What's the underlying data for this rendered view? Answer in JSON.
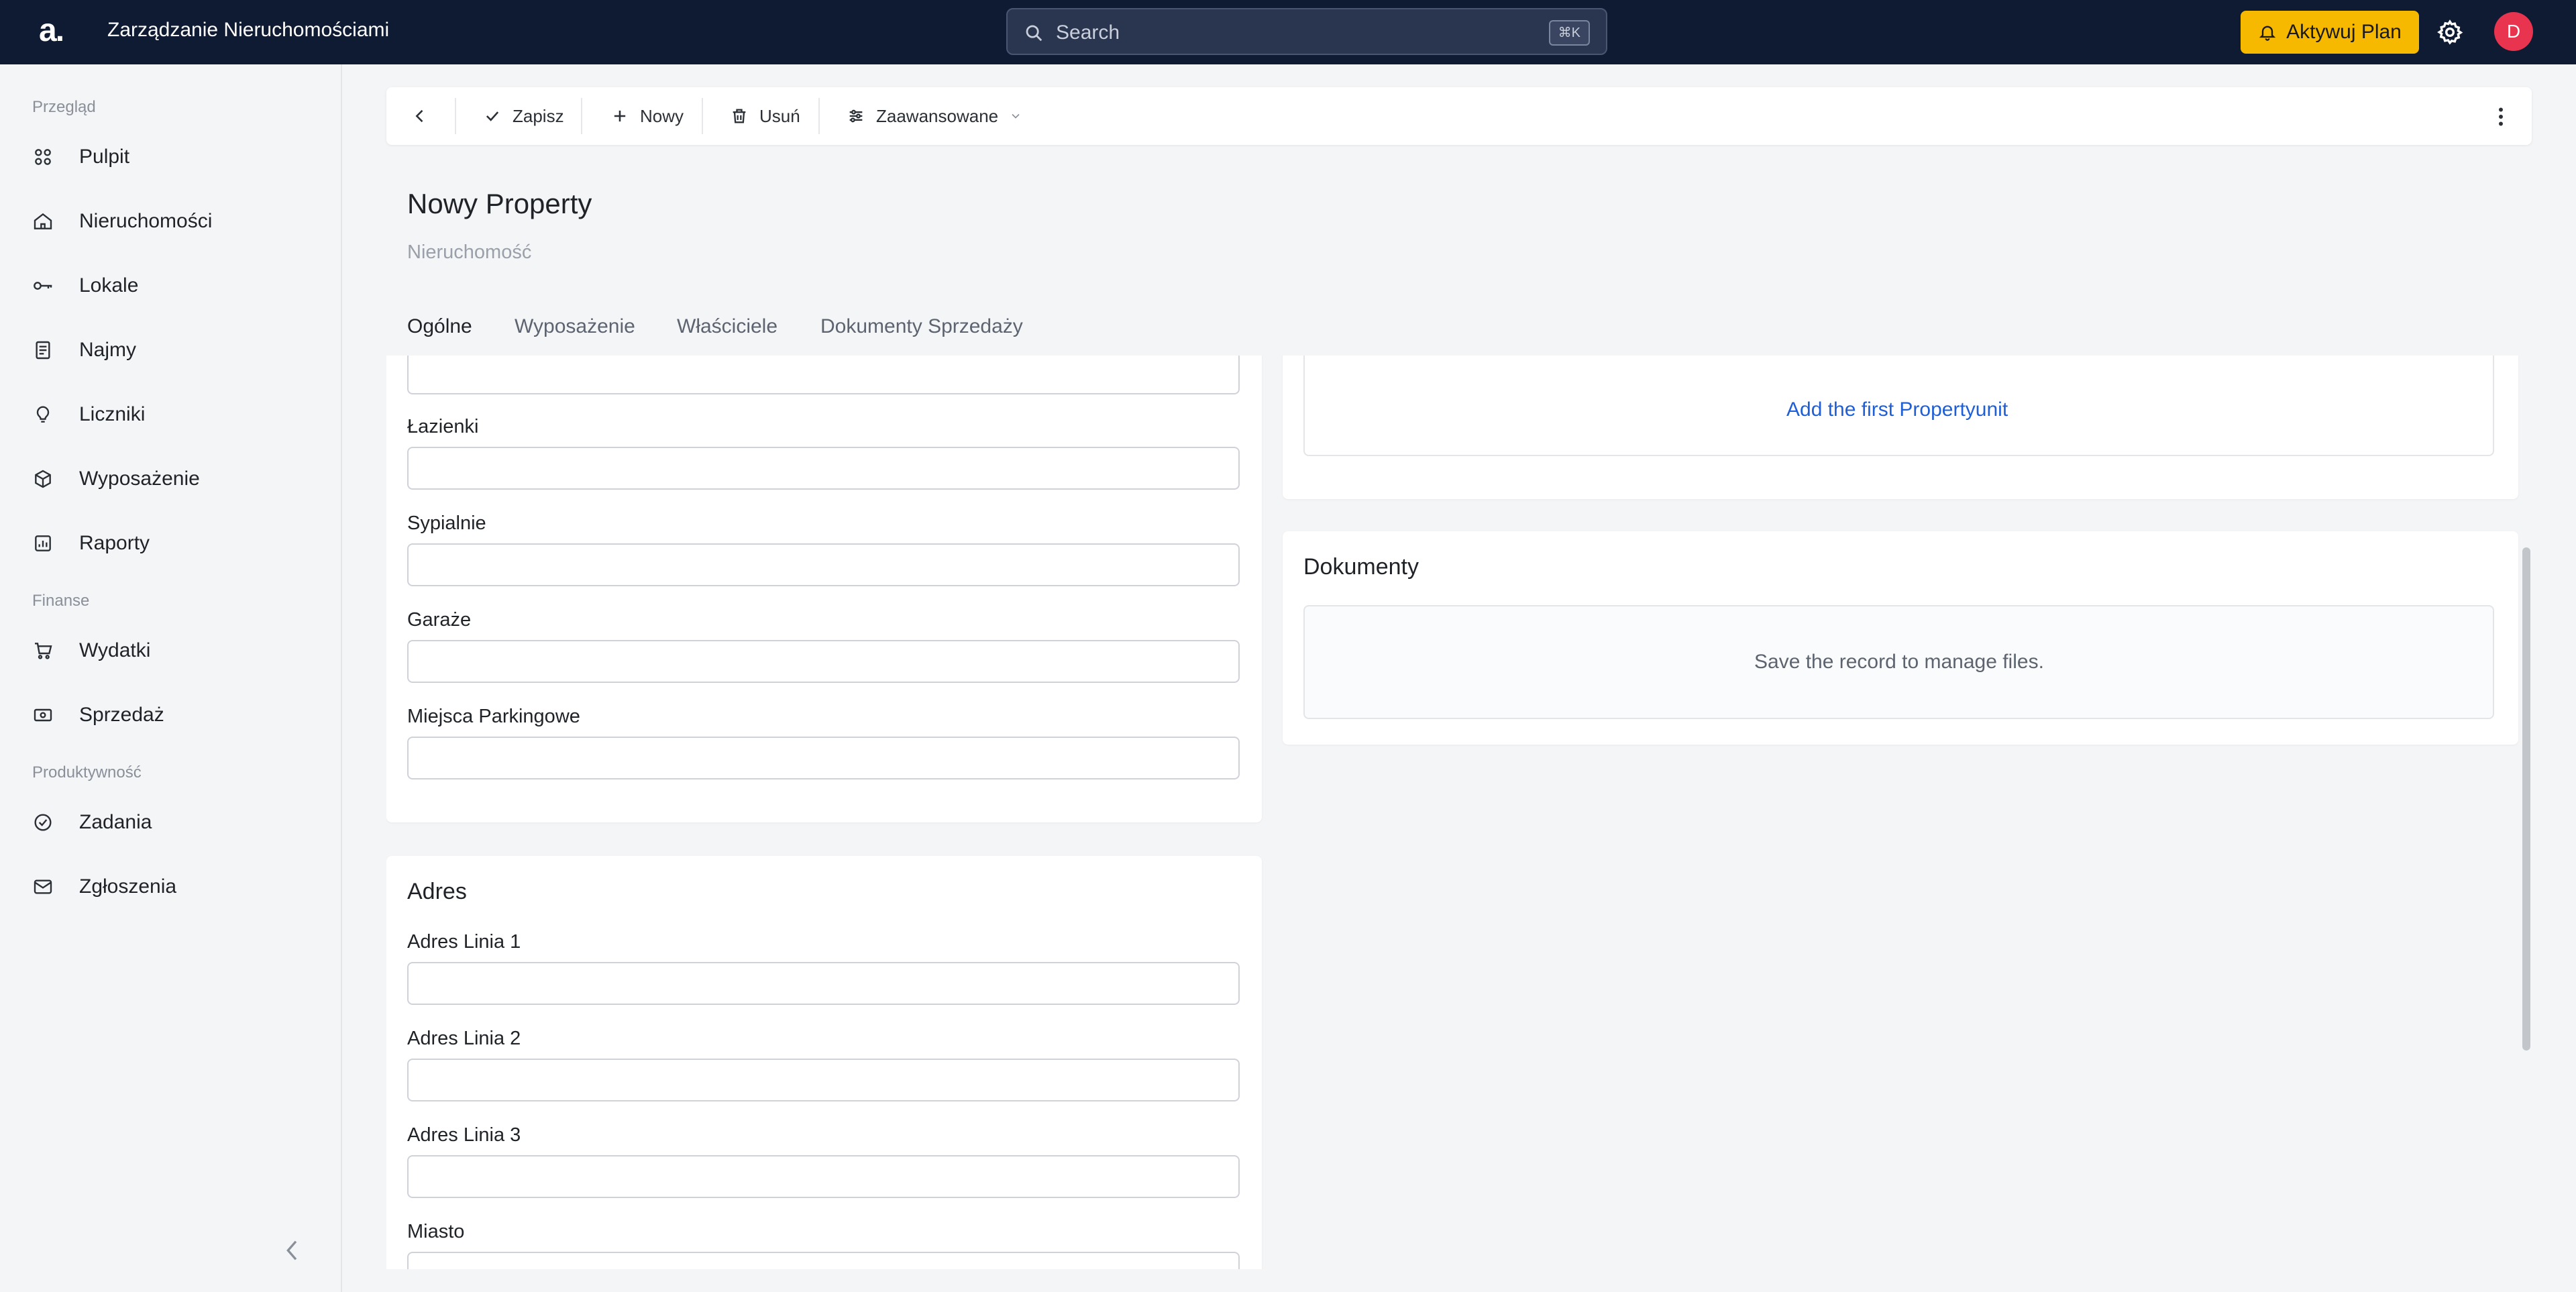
{
  "app": {
    "logo": "a.",
    "title": "Zarządzanie Nieruchomościami"
  },
  "search": {
    "placeholder": "Search",
    "shortcut": "⌘K"
  },
  "header_actions": {
    "plan_label": "Aktywuj Plan",
    "avatar_initial": "D"
  },
  "sidebar": {
    "sections": [
      {
        "label": "Przegląd",
        "items": [
          {
            "label": "Pulpit",
            "icon": "dashboard-icon"
          },
          {
            "label": "Nieruchomości",
            "icon": "home-icon"
          },
          {
            "label": "Lokale",
            "icon": "key-icon"
          },
          {
            "label": "Najmy",
            "icon": "document-icon"
          },
          {
            "label": "Liczniki",
            "icon": "bulb-icon"
          },
          {
            "label": "Wyposażenie",
            "icon": "cube-icon"
          },
          {
            "label": "Raporty",
            "icon": "report-icon"
          }
        ]
      },
      {
        "label": "Finanse",
        "items": [
          {
            "label": "Wydatki",
            "icon": "cart-icon"
          },
          {
            "label": "Sprzedaż",
            "icon": "cash-icon"
          }
        ]
      },
      {
        "label": "Produktywność",
        "items": [
          {
            "label": "Zadania",
            "icon": "check-circle-icon"
          },
          {
            "label": "Zgłoszenia",
            "icon": "mail-icon"
          }
        ]
      }
    ]
  },
  "toolbar": {
    "save": "Zapisz",
    "new": "Nowy",
    "delete": "Usuń",
    "advanced": "Zaawansowane"
  },
  "page": {
    "title": "Nowy Property",
    "subtitle": "Nieruchomość"
  },
  "tabs": [
    {
      "label": "Ogólne",
      "active": true
    },
    {
      "label": "Wyposażenie",
      "active": false
    },
    {
      "label": "Właściciele",
      "active": false
    },
    {
      "label": "Dokumenty Sprzedaży",
      "active": false
    }
  ],
  "form": {
    "details_fields": [
      {
        "label": "Łazienki",
        "value": ""
      },
      {
        "label": "Sypialnie",
        "value": ""
      },
      {
        "label": "Garaże",
        "value": ""
      },
      {
        "label": "Miejsca Parkingowe",
        "value": ""
      }
    ],
    "address": {
      "title": "Adres",
      "fields": [
        {
          "label": "Adres Linia 1",
          "value": ""
        },
        {
          "label": "Adres Linia 2",
          "value": ""
        },
        {
          "label": "Adres Linia 3",
          "value": ""
        },
        {
          "label": "Miasto",
          "value": ""
        }
      ]
    }
  },
  "units_panel": {
    "add_link": "Add the first Propertyunit"
  },
  "documents_panel": {
    "title": "Dokumenty",
    "empty_text": "Save the record to manage files."
  }
}
